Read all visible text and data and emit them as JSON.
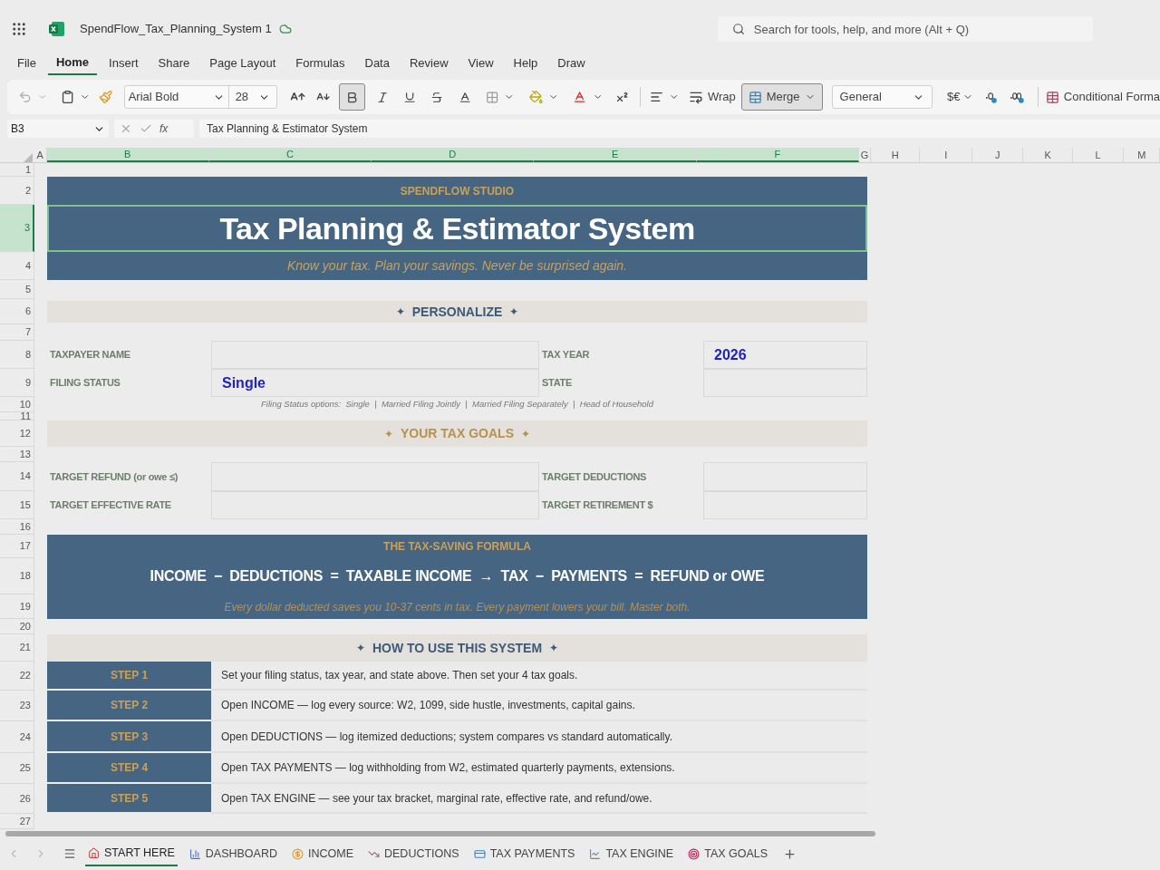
{
  "app": {
    "title": "SpendFlow_Tax_Planning_System 1",
    "search_placeholder": "Search for tools, help, and more (Alt + Q)"
  },
  "menu": [
    {
      "label": "File",
      "selected": false
    },
    {
      "label": "Home",
      "selected": true
    },
    {
      "label": "Insert",
      "selected": false
    },
    {
      "label": "Share",
      "selected": false
    },
    {
      "label": "Page Layout",
      "selected": false
    },
    {
      "label": "Formulas",
      "selected": false
    },
    {
      "label": "Data",
      "selected": false
    },
    {
      "label": "Review",
      "selected": false
    },
    {
      "label": "View",
      "selected": false
    },
    {
      "label": "Help",
      "selected": false
    },
    {
      "label": "Draw",
      "selected": false
    }
  ],
  "toolbar": {
    "font": "Arial Bold",
    "size": "28",
    "bold_selected": true,
    "wrap": "Wrap",
    "merge": {
      "label": "Merge",
      "selected": true
    },
    "number_format": "General",
    "currency": "$€",
    "conditional": "Conditional Forma"
  },
  "formula_bar": {
    "cell": "B3",
    "fx": "fx",
    "formula": "Tax Planning & Estimator System"
  },
  "columns": [
    {
      "label": "A",
      "selected": false
    },
    {
      "label": "B",
      "selected": true
    },
    {
      "label": "C",
      "selected": true
    },
    {
      "label": "D",
      "selected": true
    },
    {
      "label": "E",
      "selected": true
    },
    {
      "label": "F",
      "selected": true
    },
    {
      "label": "G",
      "selected": false
    },
    {
      "label": "H",
      "selected": false
    },
    {
      "label": "I",
      "selected": false
    },
    {
      "label": "J",
      "selected": false
    },
    {
      "label": "K",
      "selected": false
    },
    {
      "label": "L",
      "selected": false
    },
    {
      "label": "M",
      "selected": false
    }
  ],
  "rows": [
    {
      "label": "1",
      "selected": false
    },
    {
      "label": "2",
      "selected": false
    },
    {
      "label": "3",
      "selected": true
    },
    {
      "label": "4",
      "selected": false
    },
    {
      "label": "5",
      "selected": false
    },
    {
      "label": "6",
      "selected": false
    },
    {
      "label": "7",
      "selected": false
    },
    {
      "label": "8",
      "selected": false
    },
    {
      "label": "9",
      "selected": false
    },
    {
      "label": "10",
      "selected": false
    },
    {
      "label": "11",
      "selected": false
    },
    {
      "label": "12",
      "selected": false
    },
    {
      "label": "13",
      "selected": false
    },
    {
      "label": "14",
      "selected": false
    },
    {
      "label": "15",
      "selected": false
    },
    {
      "label": "16",
      "selected": false
    },
    {
      "label": "17",
      "selected": false
    },
    {
      "label": "18",
      "selected": false
    },
    {
      "label": "19",
      "selected": false
    },
    {
      "label": "20",
      "selected": false
    },
    {
      "label": "21",
      "selected": false
    },
    {
      "label": "22",
      "selected": false
    },
    {
      "label": "23",
      "selected": false
    },
    {
      "label": "24",
      "selected": false
    },
    {
      "label": "25",
      "selected": false
    },
    {
      "label": "26",
      "selected": false
    },
    {
      "label": "27",
      "selected": false
    }
  ],
  "banner": {
    "brand": "SPENDFLOW STUDIO",
    "title": "Tax Planning & Estimator System",
    "tagline": "Know your tax. Plan your savings. Never be surprised again.",
    "selected": true
  },
  "personalize": {
    "heading": "PERSONALIZE",
    "ornaments": [
      "✦",
      "✦"
    ],
    "fields": [
      {
        "label": "TAXPAYER NAME"
      },
      {
        "label": "TAX YEAR",
        "value": "2026"
      },
      {
        "label": "FILING STATUS",
        "value": "Single"
      },
      {
        "label": "STATE"
      }
    ],
    "note": "Filing Status options:  Single  |  Married Filing Jointly  |  Married Filing Separately  |  Head of Household"
  },
  "goals": {
    "heading": "YOUR TAX GOALS",
    "ornaments": [
      "✦",
      "✦"
    ],
    "fields": [
      {
        "label": "TARGET REFUND (or owe ≤)"
      },
      {
        "label": "TARGET DEDUCTIONS"
      },
      {
        "label": "TARGET EFFECTIVE RATE"
      },
      {
        "label": "TARGET RETIREMENT $"
      }
    ]
  },
  "formula": {
    "title": "THE TAX-SAVING FORMULA",
    "equation": "INCOME  −  DEDUCTIONS  =  TAXABLE INCOME  →  TAX  −  PAYMENTS  =  REFUND or OWE",
    "note": "Every dollar deducted saves you 10-37 cents in tax. Every payment lowers your bill. Master both."
  },
  "howto": {
    "heading": "HOW TO USE THIS SYSTEM",
    "ornaments": [
      "✦",
      "✦"
    ],
    "steps": [
      {
        "label": "STEP 1",
        "text": "Set your filing status, tax year, and state above. Then set your 4 tax goals."
      },
      {
        "label": "STEP 2",
        "text": "Open INCOME — log every source: W2, 1099, side hustle, investments, capital gains."
      },
      {
        "label": "STEP 3",
        "text": "Open DEDUCTIONS — log itemized deductions; system compares vs standard automatically."
      },
      {
        "label": "STEP 4",
        "text": "Open TAX PAYMENTS — log withholding from W2, estimated quarterly payments, extensions."
      },
      {
        "label": "STEP 5",
        "text": "Open TAX ENGINE — see your tax bracket, marginal rate, effective rate, and refund/owe."
      }
    ]
  },
  "sheet_tabs": [
    {
      "label": "START HERE",
      "kind": "home",
      "selected": true
    },
    {
      "label": "DASHBOARD",
      "kind": "dashboard",
      "selected": false
    },
    {
      "label": "INCOME",
      "kind": "income",
      "selected": false
    },
    {
      "label": "DEDUCTIONS",
      "kind": "deductions",
      "selected": false
    },
    {
      "label": "TAX PAYMENTS",
      "kind": "payments",
      "selected": false
    },
    {
      "label": "TAX ENGINE",
      "kind": "engine",
      "selected": false
    },
    {
      "label": "TAX GOALS",
      "kind": "goals",
      "selected": false
    }
  ]
}
